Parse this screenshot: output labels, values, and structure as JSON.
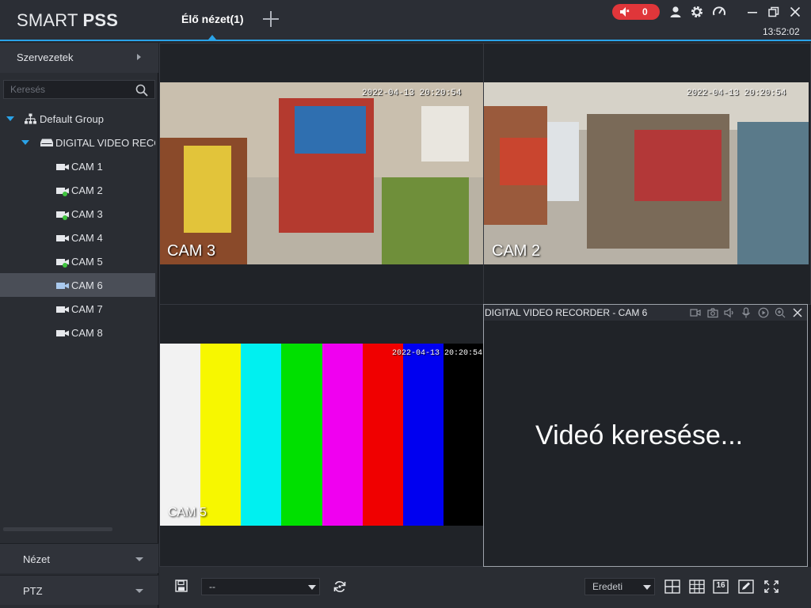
{
  "app": {
    "logo_light": "SMART ",
    "logo_bold": "PSS",
    "tabs": [
      {
        "label": "Élő nézet(1)"
      }
    ],
    "alarm_count": "0",
    "clock": "13:52:02"
  },
  "sidebar": {
    "org_label": "Szervezetek",
    "search_placeholder": "Keresés",
    "tree": [
      {
        "label": "Default Group"
      },
      {
        "label": "DIGITAL VIDEO RECORDER"
      },
      {
        "label": "CAM 1",
        "online": false
      },
      {
        "label": "CAM 2",
        "online": true
      },
      {
        "label": "CAM 3",
        "online": true
      },
      {
        "label": "CAM 4",
        "online": false
      },
      {
        "label": "CAM 5",
        "online": true
      },
      {
        "label": "CAM 6",
        "online": false,
        "selected": true
      },
      {
        "label": "CAM 7",
        "online": false
      },
      {
        "label": "CAM 8",
        "online": false
      }
    ],
    "bottom_panels": [
      {
        "label": "Nézet"
      },
      {
        "label": "PTZ"
      }
    ]
  },
  "grid": {
    "cells": [
      {
        "cam_label": "CAM 3",
        "timestamp": "2022-04-13 20:20:54"
      },
      {
        "cam_label": "CAM 2",
        "timestamp": "2022-04-13 20:20:54"
      },
      {
        "cam_label": "CAM 5",
        "timestamp": "2022-04-13 20:20:54"
      },
      {
        "title": "DIGITAL VIDEO RECORDER - CAM 6",
        "status": "Videó keresése..."
      }
    ],
    "color_bars": [
      "#f2f2f2",
      "#f7f700",
      "#00f0f0",
      "#00e000",
      "#f000f0",
      "#f00000",
      "#0000f0",
      "#000000"
    ]
  },
  "toolbar": {
    "layout_value": "--",
    "ratio_value": "Eredeti",
    "layout16_label": "16"
  },
  "colors": {
    "accent": "#2aa3e8",
    "alarm": "#e0363a",
    "online": "#3ec43e"
  }
}
